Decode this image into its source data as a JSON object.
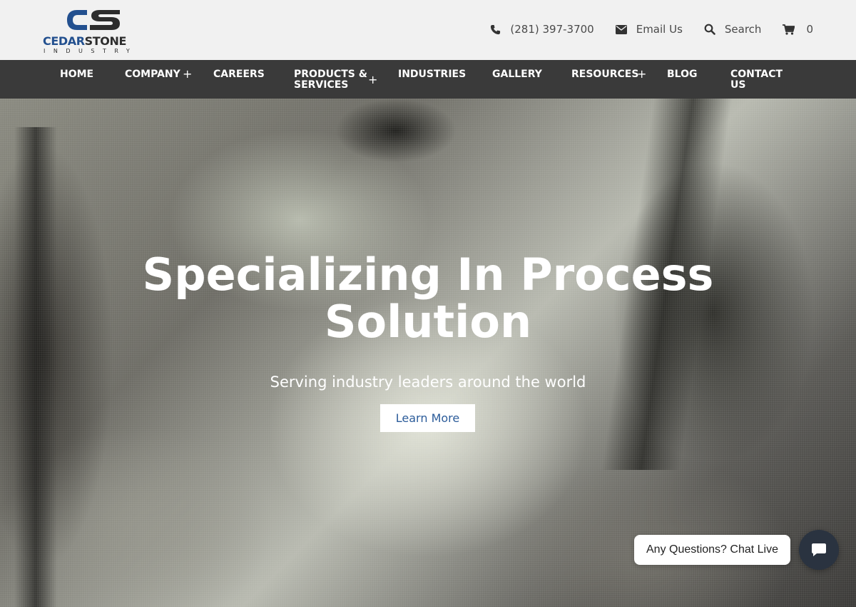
{
  "brand": {
    "name_part1": "CEDAR",
    "name_part2": "STONE",
    "tagline": "INDUSTRY",
    "colors": {
      "blue": "#23508f",
      "dark": "#2d2d2d"
    }
  },
  "top_links": {
    "phone": {
      "icon": "phone-icon",
      "label": "(281) 397-3700"
    },
    "email": {
      "icon": "envelope-icon",
      "label": "Email Us"
    },
    "search": {
      "icon": "search-icon",
      "label": "Search"
    },
    "cart": {
      "icon": "cart-icon",
      "count": "0"
    }
  },
  "nav": {
    "background": "#3a3a3a",
    "items": [
      {
        "label": "HOME",
        "has_submenu": false
      },
      {
        "label": "COMPANY",
        "has_submenu": true
      },
      {
        "label": "CAREERS",
        "has_submenu": false
      },
      {
        "label": "PRODUCTS & SERVICES",
        "line1": "PRODUCTS &",
        "line2": "SERVICES",
        "has_submenu": true
      },
      {
        "label": "INDUSTRIES",
        "has_submenu": false
      },
      {
        "label": "GALLERY",
        "has_submenu": false
      },
      {
        "label": "RESOURCES",
        "has_submenu": true
      },
      {
        "label": "BLOG",
        "has_submenu": false
      },
      {
        "label": "CONTACT US",
        "line1": "CONTACT",
        "line2": "US",
        "has_submenu": false
      }
    ],
    "submenu_icon": "plus-icon",
    "submenu_symbol": "+"
  },
  "hero": {
    "title_line1": "Specializing In Process",
    "title_line2": "Solution",
    "subtitle": "Serving industry leaders around the world",
    "cta_label": "Learn More",
    "cta_color": "#2c5c9a"
  },
  "chat": {
    "prompt": "Any Questions? Chat Live",
    "icon": "chat-icon",
    "button_color": "#2a3340"
  }
}
